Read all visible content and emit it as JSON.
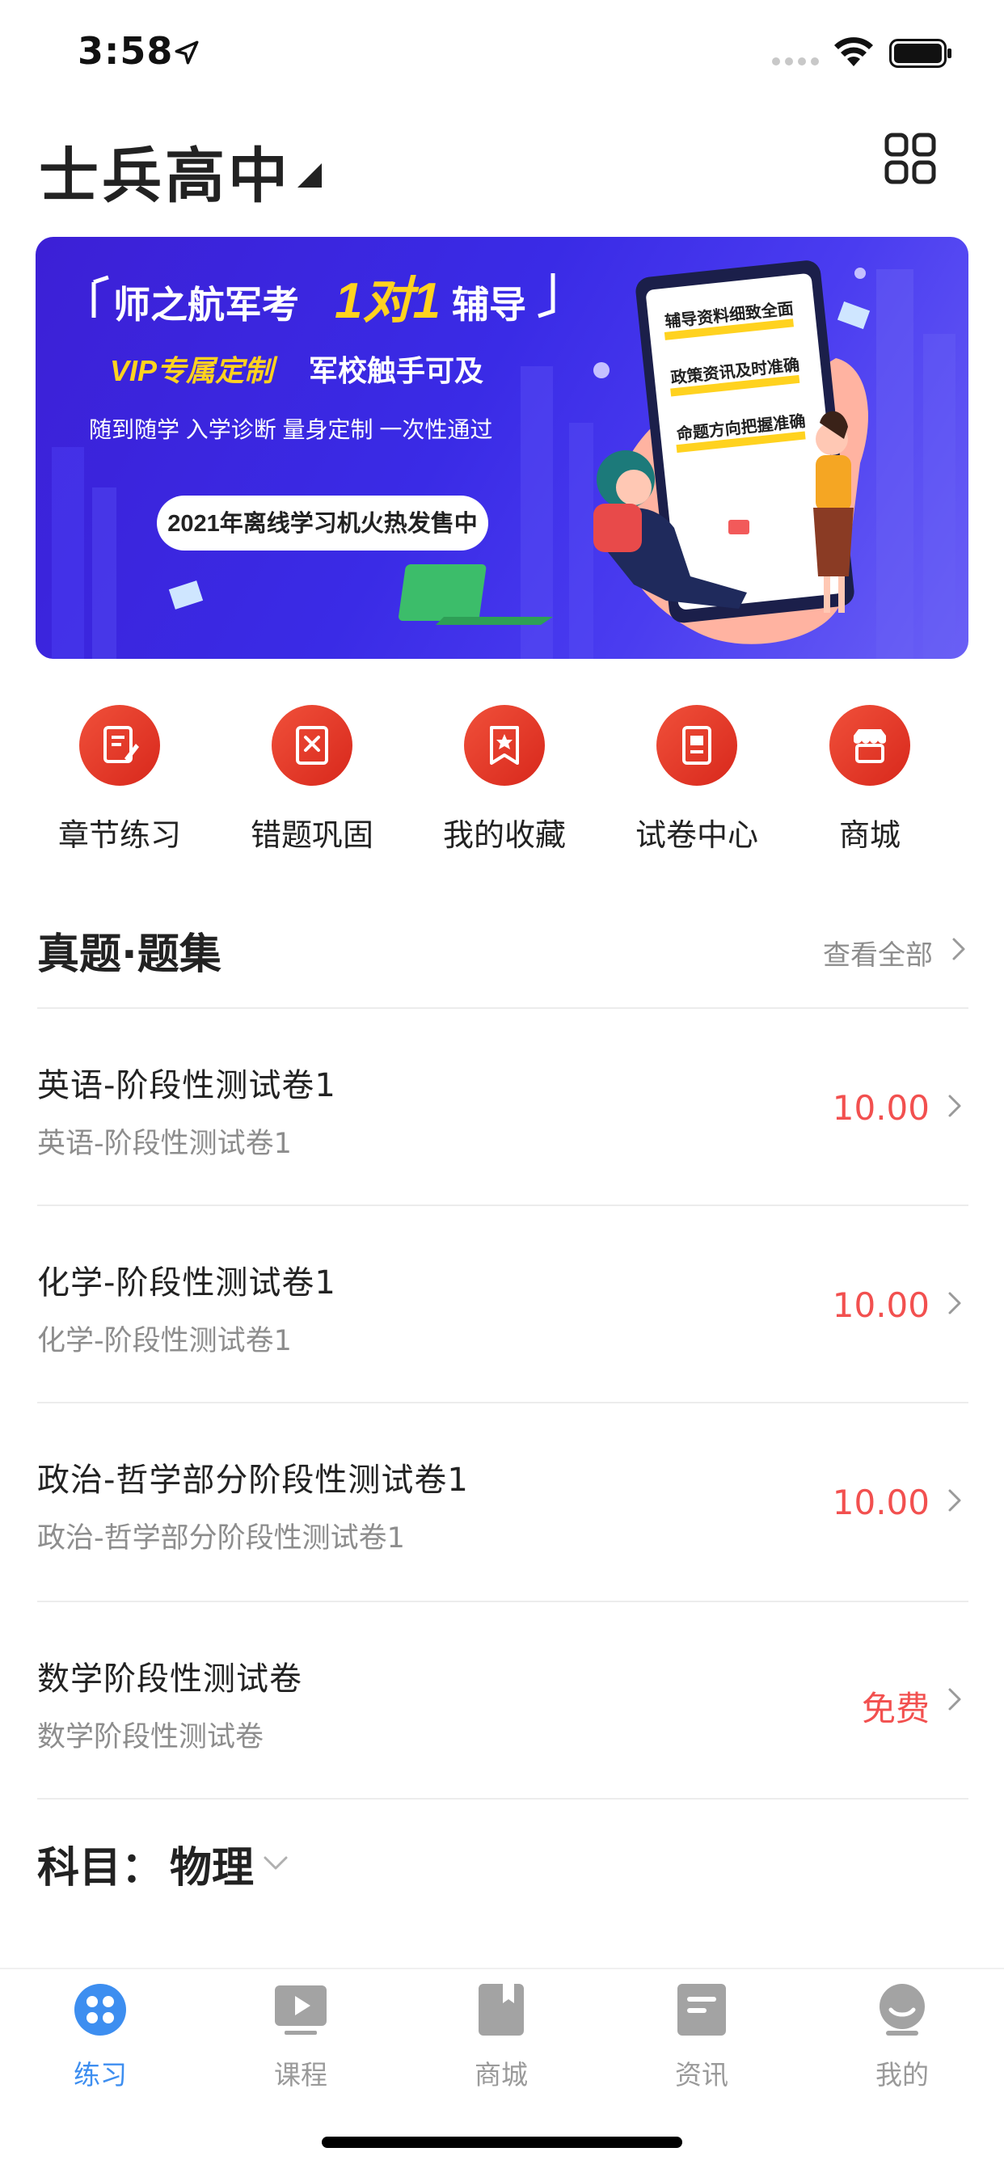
{
  "status_bar": {
    "time": "3:58"
  },
  "header": {
    "school_name": "士兵高中"
  },
  "banner": {
    "title_prefix": "师之航军考",
    "title_highlight": "1对1",
    "title_suffix": "辅导",
    "vip_text": "VIP专属定制",
    "vip_tail": "军校触手可及",
    "features": "随到随学  入学诊断  量身定制  一次性通过",
    "pill": "2021年离线学习机火热发售中",
    "card_lines": [
      "辅导资料细致全面",
      "政策资讯及时准确",
      "命题方向把握准确"
    ],
    "colors": {
      "bg": "#3a2be6",
      "accent": "#ffd21f"
    }
  },
  "quick_menu": [
    {
      "label": "章节练习",
      "icon": "notebook-pen-icon"
    },
    {
      "label": "错题巩固",
      "icon": "wrong-doc-icon"
    },
    {
      "label": "我的收藏",
      "icon": "bookmark-star-icon"
    },
    {
      "label": "试卷中心",
      "icon": "exam-book-icon"
    },
    {
      "label": "商城",
      "icon": "store-icon"
    }
  ],
  "section": {
    "title": "真题·题集",
    "view_all": "查看全部"
  },
  "papers": [
    {
      "title": "英语-阶段性测试卷1",
      "subtitle": "英语-阶段性测试卷1",
      "price": "10.00"
    },
    {
      "title": "化学-阶段性测试卷1",
      "subtitle": "化学-阶段性测试卷1",
      "price": "10.00"
    },
    {
      "title": "政治-哲学部分阶段性测试卷1",
      "subtitle": "政治-哲学部分阶段性测试卷1",
      "price": "10.00"
    },
    {
      "title": "数学阶段性测试卷",
      "subtitle": "数学阶段性测试卷",
      "price": "免费"
    }
  ],
  "subject": {
    "label": "科目：",
    "value": "物理"
  },
  "tabs": [
    {
      "label": "练习",
      "icon": "practice-icon",
      "active": true
    },
    {
      "label": "课程",
      "icon": "video-play-icon",
      "active": false
    },
    {
      "label": "商城",
      "icon": "bookmark-icon",
      "active": false
    },
    {
      "label": "资讯",
      "icon": "news-icon",
      "active": false
    },
    {
      "label": "我的",
      "icon": "user-icon",
      "active": false
    }
  ],
  "colors": {
    "accent_red": "#e2392a",
    "price_red": "#f2504f",
    "tab_active": "#3d8ef0",
    "tab_inactive": "#9a9a9a"
  }
}
